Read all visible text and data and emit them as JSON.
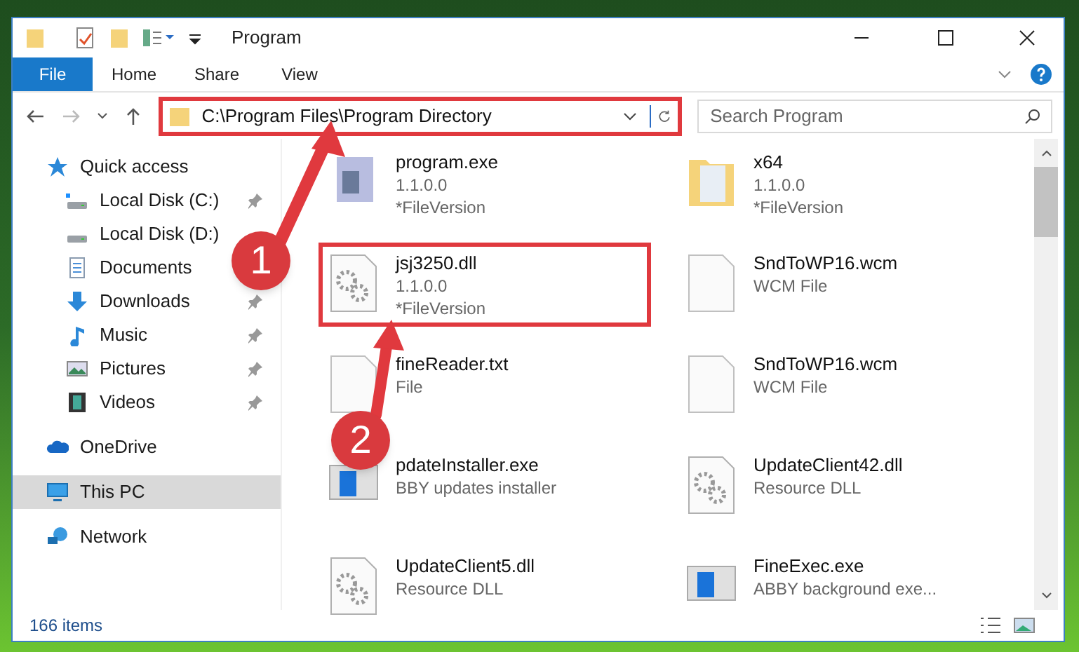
{
  "window": {
    "title": "Program"
  },
  "ribbon_tabs": [
    {
      "label": "File",
      "selected": true
    },
    {
      "label": "Home",
      "selected": false
    },
    {
      "label": "Share",
      "selected": false
    },
    {
      "label": "View",
      "selected": false
    }
  ],
  "address": {
    "path": "C:\\Program Files\\Program Directory",
    "highlighted": true
  },
  "search": {
    "placeholder": "Search Program"
  },
  "sidebar": {
    "items": [
      {
        "label": "Quick access",
        "kind": "quick",
        "pinned": false,
        "selected": false,
        "children": [
          {
            "label": "Local Disk (C:)",
            "kind": "diskc",
            "pinned": true,
            "selected": false
          },
          {
            "label": "Local Disk (D:)",
            "kind": "disk",
            "pinned": false,
            "selected": false
          },
          {
            "label": "Documents",
            "kind": "documents",
            "pinned": false,
            "selected": false
          },
          {
            "label": "Downloads",
            "kind": "downloads",
            "pinned": true,
            "selected": false
          },
          {
            "label": "Music",
            "kind": "music",
            "pinned": true,
            "selected": false
          },
          {
            "label": "Pictures",
            "kind": "pictures",
            "pinned": true,
            "selected": false
          },
          {
            "label": "Videos",
            "kind": "videos",
            "pinned": true,
            "selected": false
          }
        ]
      },
      {
        "label": "OneDrive",
        "kind": "cloud",
        "pinned": false,
        "selected": false
      },
      {
        "label": "This PC",
        "kind": "pc",
        "pinned": false,
        "selected": true
      },
      {
        "label": "Network",
        "kind": "network",
        "pinned": false,
        "selected": false
      }
    ]
  },
  "files": [
    {
      "name": "program.exe",
      "lines": [
        "1.1.0.0",
        "*FileVersion"
      ],
      "kind": "exe",
      "highlighted": false
    },
    {
      "name": "x64",
      "lines": [
        "1.1.0.0",
        "*FileVersion"
      ],
      "kind": "folder",
      "highlighted": false
    },
    {
      "name": "jsj3250.dll",
      "lines": [
        "1.1.0.0",
        "*FileVersion"
      ],
      "kind": "dll",
      "highlighted": true
    },
    {
      "name": "SndToWP16.wcm",
      "lines": [
        "WCM File"
      ],
      "kind": "file",
      "highlighted": false
    },
    {
      "name": "fineReader.txt",
      "lines": [
        "File"
      ],
      "kind": "file",
      "highlighted": false
    },
    {
      "name": "SndToWP16.wcm",
      "lines": [
        "WCM File"
      ],
      "kind": "file",
      "highlighted": false
    },
    {
      "name": "pdateInstaller.exe",
      "lines": [
        "BBY updates installer"
      ],
      "kind": "app",
      "highlighted": false
    },
    {
      "name": "UpdateClient42.dll",
      "lines": [
        "Resource DLL"
      ],
      "kind": "dll",
      "highlighted": false
    },
    {
      "name": "UpdateClient5.dll",
      "lines": [
        "Resource DLL"
      ],
      "kind": "dll",
      "highlighted": false
    },
    {
      "name": "FineExec.exe",
      "lines": [
        "ABBY background exe..."
      ],
      "kind": "app",
      "highlighted": false
    }
  ],
  "status_bar": {
    "items": "166 items"
  },
  "callouts": [
    "1",
    "2"
  ]
}
